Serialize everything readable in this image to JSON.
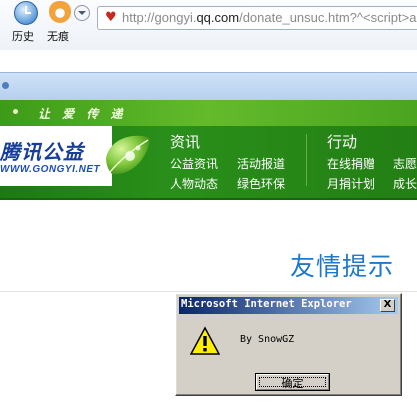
{
  "browser": {
    "history_label": "历史",
    "incognito_label": "无痕",
    "url": {
      "prefix": "http://gongyi.",
      "domain": "qq.com",
      "suffix": "/donate_unsuc.htm?^<script>a"
    }
  },
  "site": {
    "slogan": "让 爱 传 递",
    "logo_text": "腾讯公益",
    "logo_url": "WWW.GONGYI.NET",
    "nav": {
      "news_title": "资讯",
      "news_links": [
        "公益资讯",
        "活动报道",
        "人物动态",
        "绿色环保"
      ],
      "action_title": "行动",
      "action_links": [
        "在线捐赠",
        "志愿",
        "月捐计划",
        "成长"
      ]
    },
    "notice_heading": "友情提示"
  },
  "dialog": {
    "title": "Microsoft Internet Explorer",
    "close_glyph": "X",
    "message": "By SnowGZ",
    "ok_label": "确定"
  }
}
